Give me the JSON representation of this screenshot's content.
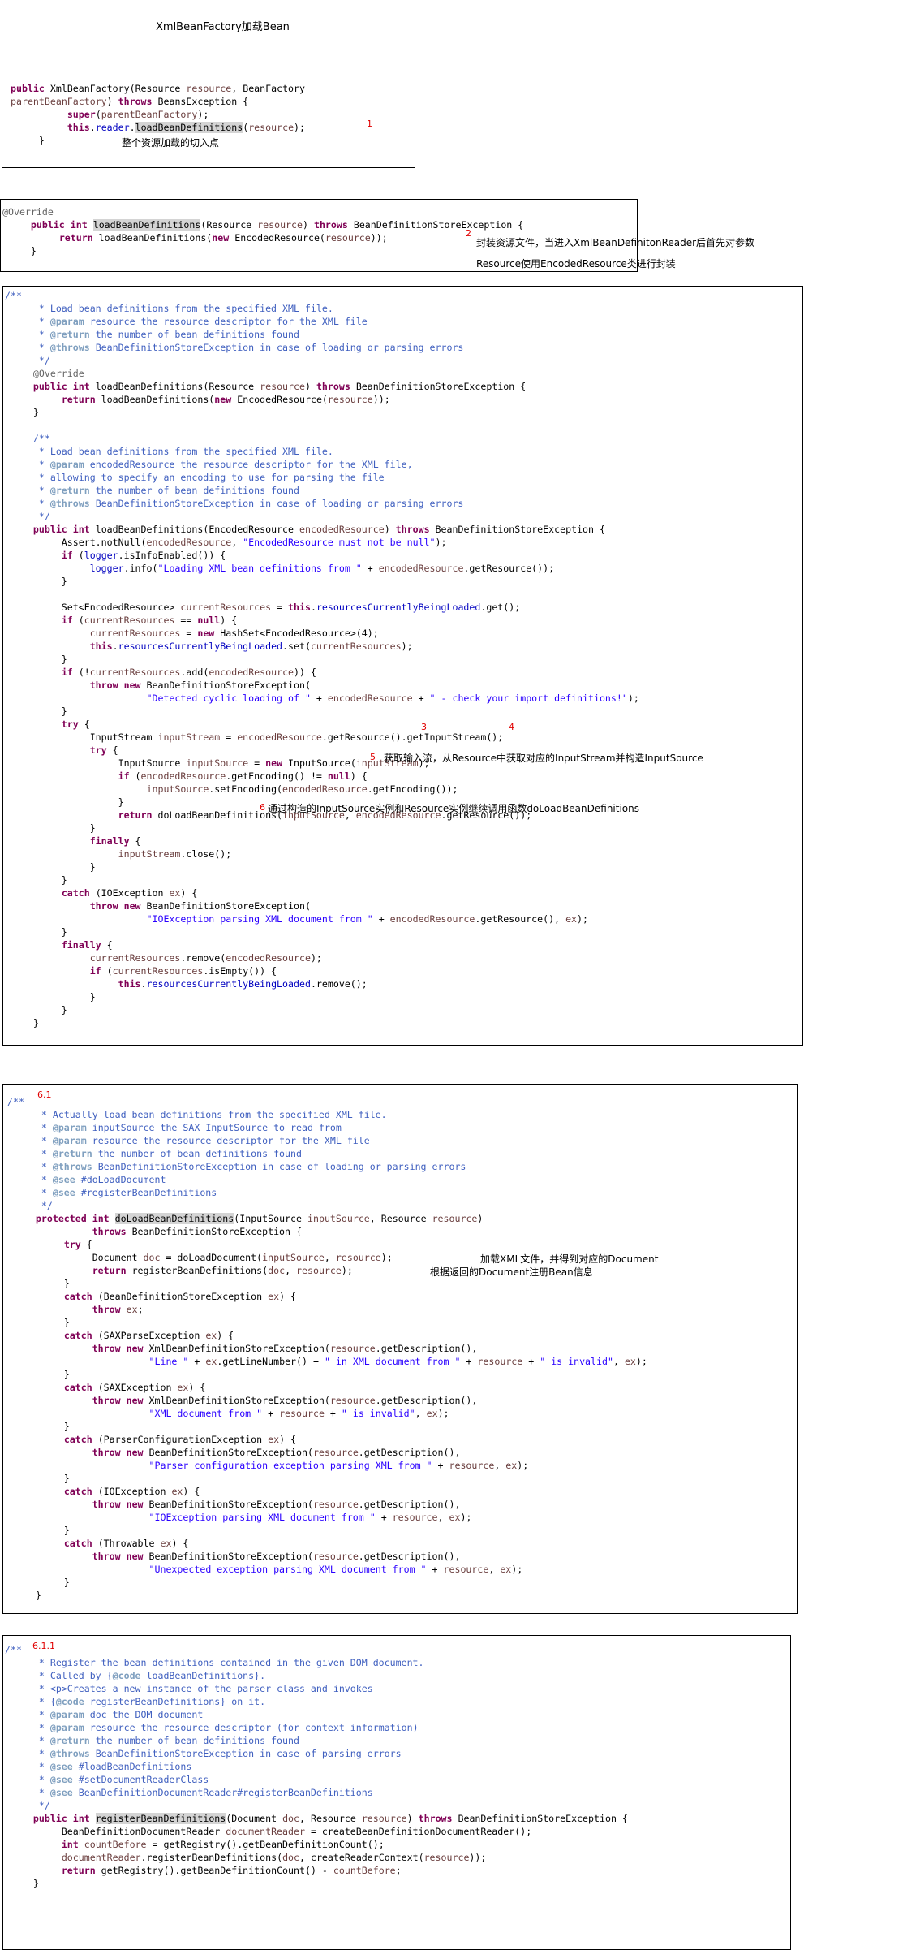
{
  "page_title": "XmlBeanFactory加载Bean",
  "box1": {
    "lines": [
      "public XmlBeanFactory(Resource resource, BeanFactory",
      "parentBeanFactory) throws BeansException {",
      "          super(parentBeanFactory);",
      "          this.reader.loadBeanDefinitions(resource);",
      "     }"
    ],
    "marker": "1",
    "annotation": "整个资源加载的切入点"
  },
  "box2": {
    "lines": [
      "@Override",
      "     public int loadBeanDefinitions(Resource resource) throws BeanDefinitionStoreException {",
      "          return loadBeanDefinitions(new EncodedResource(resource));",
      "     }"
    ],
    "marker": "2",
    "annotation_line1": "封装资源文件，当进入XmlBeanDefinitonReader后首先对参数",
    "annotation_line2": "Resource使用EncodedResource类进行封装"
  },
  "box3": {
    "lines": [
      "/**",
      "      * Load bean definitions from the specified XML file.",
      "      * @param resource the resource descriptor for the XML file",
      "      * @return the number of bean definitions found",
      "      * @throws BeanDefinitionStoreException in case of loading or parsing errors",
      "      */",
      "     @Override",
      "     public int loadBeanDefinitions(Resource resource) throws BeanDefinitionStoreException {",
      "          return loadBeanDefinitions(new EncodedResource(resource));",
      "     }",
      "",
      "     /**",
      "      * Load bean definitions from the specified XML file.",
      "      * @param encodedResource the resource descriptor for the XML file,",
      "      * allowing to specify an encoding to use for parsing the file",
      "      * @return the number of bean definitions found",
      "      * @throws BeanDefinitionStoreException in case of loading or parsing errors",
      "      */",
      "     public int loadBeanDefinitions(EncodedResource encodedResource) throws BeanDefinitionStoreException {",
      "          Assert.notNull(encodedResource, \"EncodedResource must not be null\");",
      "          if (logger.isInfoEnabled()) {",
      "               logger.info(\"Loading XML bean definitions from \" + encodedResource.getResource());",
      "          }",
      "",
      "          Set<EncodedResource> currentResources = this.resourcesCurrentlyBeingLoaded.get();",
      "          if (currentResources == null) {",
      "               currentResources = new HashSet<EncodedResource>(4);",
      "               this.resourcesCurrentlyBeingLoaded.set(currentResources);",
      "          }",
      "          if (!currentResources.add(encodedResource)) {",
      "               throw new BeanDefinitionStoreException(",
      "                         \"Detected cyclic loading of \" + encodedResource + \" - check your import definitions!\");",
      "          }",
      "          try {",
      "               InputStream inputStream = encodedResource.getResource().getInputStream();",
      "               try {",
      "                    InputSource inputSource = new InputSource(inputStream);",
      "                    if (encodedResource.getEncoding() != null) {",
      "                         inputSource.setEncoding(encodedResource.getEncoding());",
      "                    }",
      "                    return doLoadBeanDefinitions(inputSource, encodedResource.getResource());",
      "               }",
      "               finally {",
      "                    inputStream.close();",
      "               }",
      "          }",
      "          catch (IOException ex) {",
      "               throw new BeanDefinitionStoreException(",
      "                         \"IOException parsing XML document from \" + encodedResource.getResource(), ex);",
      "          }",
      "          finally {",
      "               currentResources.remove(encodedResource);",
      "               if (currentResources.isEmpty()) {",
      "                    this.resourcesCurrentlyBeingLoaded.remove();",
      "               }",
      "          }",
      "     }"
    ],
    "marker3": "3",
    "marker4": "4",
    "marker5": "5",
    "note5": "获取输入流，从Resource中获取对应的InputStream并构造InputSource",
    "marker6": "6",
    "note6": "通过构造的InputSource实例和Resource实例继续调用函数doLoadBeanDefinitions"
  },
  "box4": {
    "lines": [
      "/**",
      "      * Actually load bean definitions from the specified XML file.",
      "      * @param inputSource the SAX InputSource to read from",
      "      * @param resource the resource descriptor for the XML file",
      "      * @return the number of bean definitions found",
      "      * @throws BeanDefinitionStoreException in case of loading or parsing errors",
      "      * @see #doLoadDocument",
      "      * @see #registerBeanDefinitions",
      "      */",
      "     protected int doLoadBeanDefinitions(InputSource inputSource, Resource resource)",
      "               throws BeanDefinitionStoreException {",
      "          try {",
      "               Document doc = doLoadDocument(inputSource, resource);",
      "               return registerBeanDefinitions(doc, resource);",
      "          }",
      "          catch (BeanDefinitionStoreException ex) {",
      "               throw ex;",
      "          }",
      "          catch (SAXParseException ex) {",
      "               throw new XmlBeanDefinitionStoreException(resource.getDescription(),",
      "                         \"Line \" + ex.getLineNumber() + \" in XML document from \" + resource + \" is invalid\", ex);",
      "          }",
      "          catch (SAXException ex) {",
      "               throw new XmlBeanDefinitionStoreException(resource.getDescription(),",
      "                         \"XML document from \" + resource + \" is invalid\", ex);",
      "          }",
      "          catch (ParserConfigurationException ex) {",
      "               throw new BeanDefinitionStoreException(resource.getDescription(),",
      "                         \"Parser configuration exception parsing XML from \" + resource, ex);",
      "          }",
      "          catch (IOException ex) {",
      "               throw new BeanDefinitionStoreException(resource.getDescription(),",
      "                         \"IOException parsing XML document from \" + resource, ex);",
      "          }",
      "          catch (Throwable ex) {",
      "               throw new BeanDefinitionStoreException(resource.getDescription(),",
      "                         \"Unexpected exception parsing XML document from \" + resource, ex);",
      "          }",
      "     }"
    ],
    "marker": "6.1",
    "note_a": "加载XML文件，并得到对应的Document",
    "note_b": "根据返回的Document注册Bean信息"
  },
  "box5": {
    "lines": [
      "/**",
      "      * Register the bean definitions contained in the given DOM document.",
      "      * Called by {@code loadBeanDefinitions}.",
      "      * <p>Creates a new instance of the parser class and invokes",
      "      * {@code registerBeanDefinitions} on it.",
      "      * @param doc the DOM document",
      "      * @param resource the resource descriptor (for context information)",
      "      * @return the number of bean definitions found",
      "      * @throws BeanDefinitionStoreException in case of parsing errors",
      "      * @see #loadBeanDefinitions",
      "      * @see #setDocumentReaderClass",
      "      * @see BeanDefinitionDocumentReader#registerBeanDefinitions",
      "      */",
      "     public int registerBeanDefinitions(Document doc, Resource resource) throws BeanDefinitionStoreException {",
      "          BeanDefinitionDocumentReader documentReader = createBeanDefinitionDocumentReader();",
      "          int countBefore = getRegistry().getBeanDefinitionCount();",
      "          documentReader.registerBeanDefinitions(doc, createReaderContext(resource));",
      "          return getRegistry().getBeanDefinitionCount() - countBefore;",
      "     }"
    ],
    "marker": "6.1.1"
  }
}
